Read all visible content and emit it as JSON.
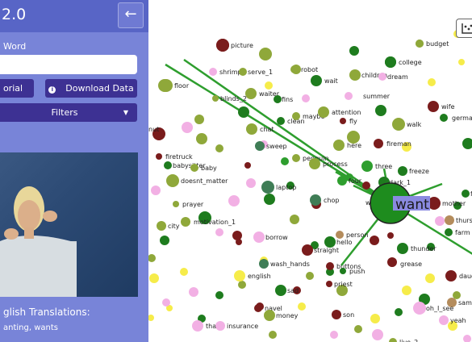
{
  "app": {
    "title": "2.0"
  },
  "sidebar": {
    "collapse_icon": "arrow-left-icon",
    "word_label": "Word",
    "word_value": "",
    "buttons": {
      "tutorial": "orial",
      "download": "Download Data",
      "download_icon": "info-icon",
      "filters": "Filters",
      "filters_icon": "caret-down-icon"
    },
    "translations": {
      "title": "glish Translations:",
      "text": "anting, wants"
    }
  },
  "graph": {
    "center": "want",
    "colors": {
      "dark_green": "#1e7c1e",
      "green": "#2e9e2e",
      "olive": "#8fa83a",
      "dark_red": "#7a1c1c",
      "pink": "#f2b0e4",
      "yellow": "#f6ec4a",
      "tan": "#b48c5c",
      "teal": "#3f7d56",
      "center_label_bg": "#8a8ae0"
    },
    "nodes": [
      {
        "label": "picture"
      },
      {
        "label": "budget"
      },
      {
        "label": "shrimp"
      },
      {
        "label": "serve_1"
      },
      {
        "label": "robot"
      },
      {
        "label": "college"
      },
      {
        "label": "children"
      },
      {
        "label": "dream"
      },
      {
        "label": "floor"
      },
      {
        "label": "wait"
      },
      {
        "label": "waiter"
      },
      {
        "label": "blinds_2"
      },
      {
        "label": "fins"
      },
      {
        "label": "summer"
      },
      {
        "label": "wife"
      },
      {
        "label": "clean"
      },
      {
        "label": "maybe"
      },
      {
        "label": "attention"
      },
      {
        "label": "fly"
      },
      {
        "label": "german"
      },
      {
        "label": "nut"
      },
      {
        "label": "walk"
      },
      {
        "label": "chat"
      },
      {
        "label": "sweep"
      },
      {
        "label": "here"
      },
      {
        "label": "fireman"
      },
      {
        "label": "firetruck"
      },
      {
        "label": "penguin"
      },
      {
        "label": "babysitter"
      },
      {
        "label": "baby"
      },
      {
        "label": "process"
      },
      {
        "label": "three"
      },
      {
        "label": "freeze"
      },
      {
        "label": "doesnt_matter"
      },
      {
        "label": "four"
      },
      {
        "label": "dark_1"
      },
      {
        "label": "laptop"
      },
      {
        "label": "mother"
      },
      {
        "label": "fa"
      },
      {
        "label": "chop"
      },
      {
        "label": "want_2"
      },
      {
        "label": "prayer"
      },
      {
        "label": "thursd"
      },
      {
        "label": "city"
      },
      {
        "label": "motivation_1"
      },
      {
        "label": "farm"
      },
      {
        "label": "borrow"
      },
      {
        "label": "hello"
      },
      {
        "label": "thunder"
      },
      {
        "label": "straight"
      },
      {
        "label": "person"
      },
      {
        "label": "ne"
      },
      {
        "label": "wash_hands"
      },
      {
        "label": "grease"
      },
      {
        "label": "buttons"
      },
      {
        "label": "english"
      },
      {
        "label": "push"
      },
      {
        "label": "daugh"
      },
      {
        "label": "priest"
      },
      {
        "label": "sad"
      },
      {
        "label": "navel"
      },
      {
        "label": "money"
      },
      {
        "label": "same"
      },
      {
        "label": "son"
      },
      {
        "label": "oh_I_see"
      },
      {
        "label": "that"
      },
      {
        "label": "insurance"
      },
      {
        "label": "yeah"
      },
      {
        "label": "live_2"
      }
    ]
  }
}
